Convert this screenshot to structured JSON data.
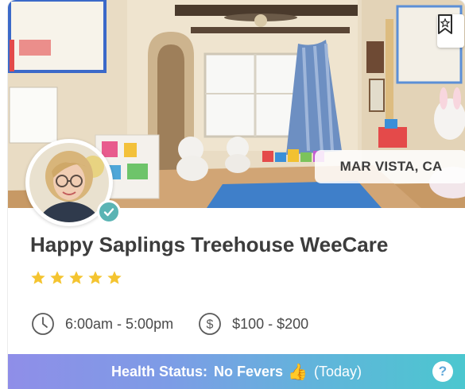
{
  "listing": {
    "location": "MAR VISTA, CA",
    "name": "Happy Saplings Treehouse WeeCare",
    "rating_stars": 5,
    "hours": "6:00am - 5:00pm",
    "price": "$100 - $200"
  },
  "health": {
    "label": "Health Status:",
    "value": "No Fevers",
    "emoji": "👍",
    "paren": "(Today)",
    "help": "?"
  },
  "colors": {
    "accent_teal": "#5ab4b4",
    "star_yellow": "#f4c430",
    "health_gradient_start": "#8f8ee8",
    "health_gradient_end": "#4bc7cf"
  },
  "icons": {
    "bookmark": "bookmark-icon",
    "verified": "check-icon",
    "clock": "clock-icon",
    "dollar": "dollar-icon",
    "help": "help-icon"
  }
}
